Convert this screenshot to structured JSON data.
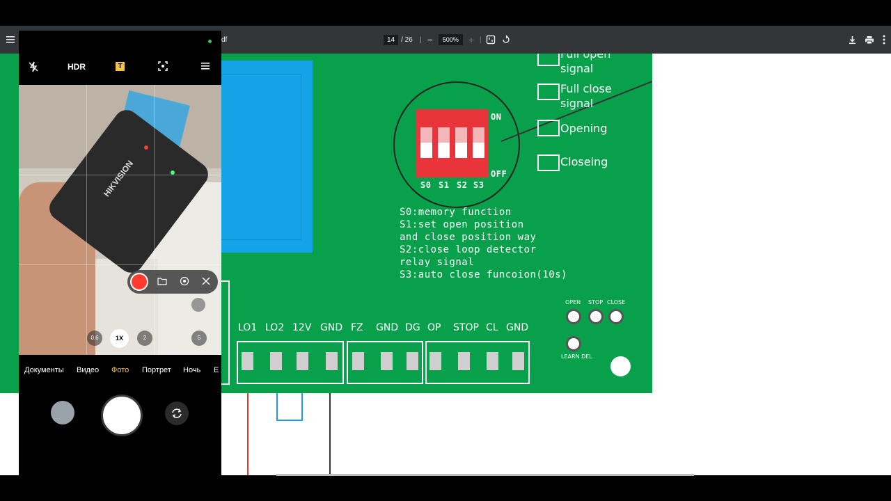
{
  "pdf_viewer": {
    "page_current": "14",
    "page_total": "/ 26",
    "zoom": "500%",
    "title_fragment": "df"
  },
  "board": {
    "legend": [
      {
        "label": "Full open\nsignal"
      },
      {
        "label": "Full close\nsignal"
      },
      {
        "label": "Opening"
      },
      {
        "label": "Closeing"
      }
    ],
    "dip_on": "ON",
    "dip_off": "OFF",
    "dip_switches": [
      "S0",
      "S1",
      "S2",
      "S3"
    ],
    "notes": [
      "S0:memory function",
      "S1:set open position",
      "and close position way",
      "S2:close loop detector",
      "relay signal",
      "S3:auto close funcoion(10s)"
    ],
    "terminals": [
      "LO1",
      "LO2",
      "12V",
      "GND",
      "FZ",
      "GND",
      "DG",
      "OP",
      "STOP",
      "CL",
      "GND"
    ],
    "buttons": {
      "open": "OPEN",
      "stop": "STOP",
      "close": "CLOSE",
      "learn_del": "LEARN DEL"
    }
  },
  "camera": {
    "hdr": "HDR",
    "zoom_options": [
      "0.6",
      "1X",
      "2",
      "5"
    ],
    "modes": [
      "Документы",
      "Видео",
      "Фото",
      "Портрет",
      "Ночь",
      "E"
    ],
    "active_mode": "Фото",
    "photo_text": "HIKVISION"
  },
  "colors": {
    "board_green": "#08a04a",
    "toolbar": "#323639",
    "dip_red": "#e8343a",
    "accent_mode": "#f6c445",
    "record_red": "#ff3b30"
  }
}
